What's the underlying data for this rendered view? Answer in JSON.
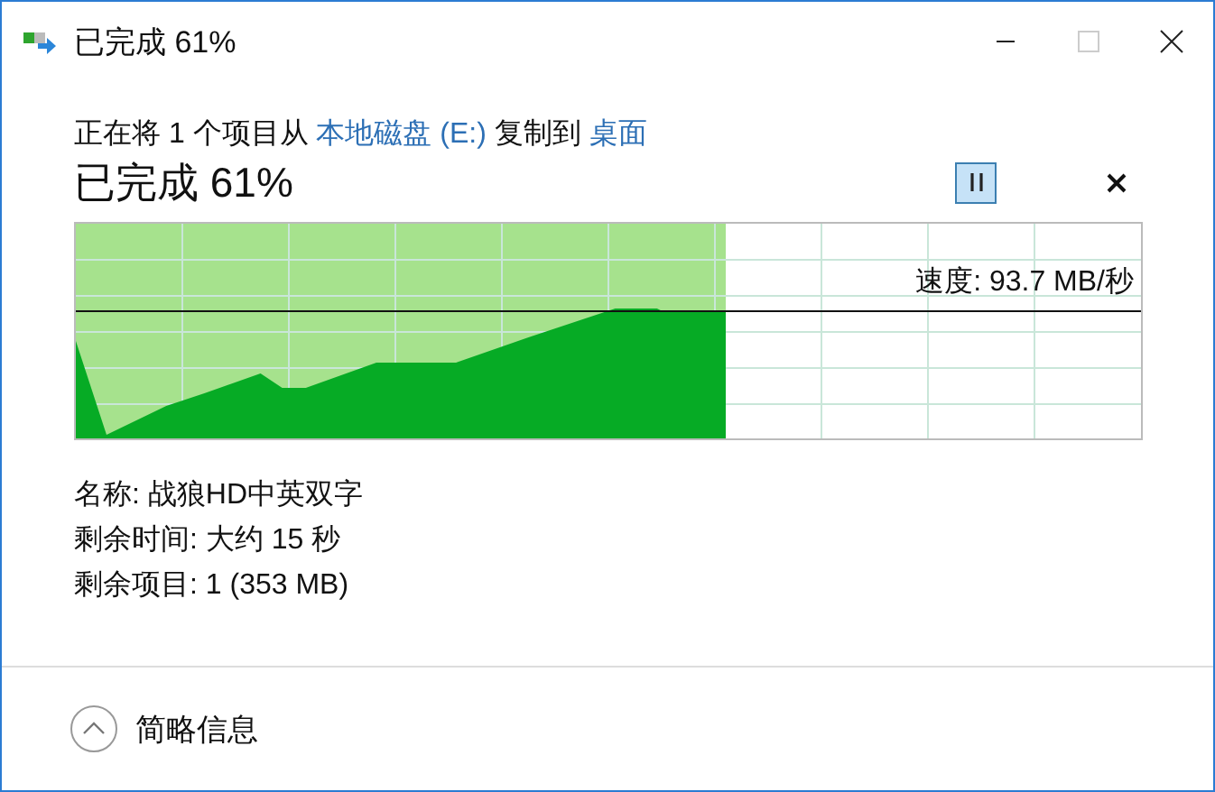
{
  "window": {
    "title": "已完成 61%"
  },
  "message": [
    {
      "kind": "text",
      "text": "正在将 1 个项目从 "
    },
    {
      "kind": "link",
      "text": "本地磁盘 (E:)"
    },
    {
      "kind": "text",
      "text": " 复制到 "
    },
    {
      "kind": "link",
      "text": "桌面"
    }
  ],
  "heading": "已完成 61%",
  "progress": {
    "level": 0.61,
    "speed": "速度: 93.7 MB/秒"
  },
  "details": [
    "名称: 战狼HD中英双字",
    "剩余时间: 大约 15 秒",
    "剩余项目: 1 (353 MB)"
  ],
  "footer": {
    "label": "简略信息",
    "expanded": true
  }
}
